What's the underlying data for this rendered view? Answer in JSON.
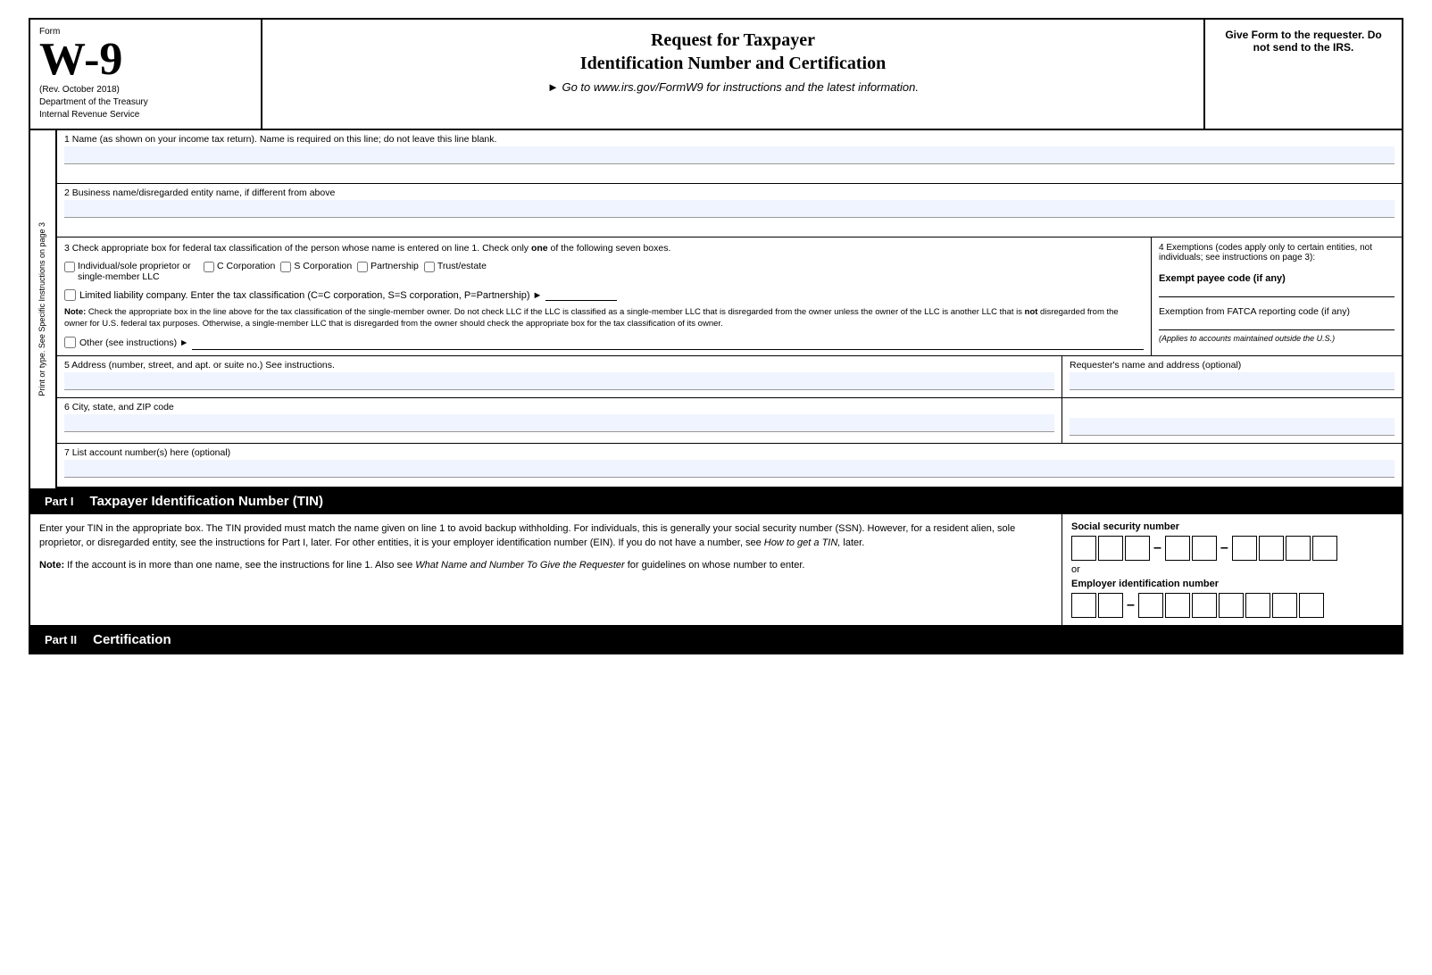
{
  "header": {
    "form_label": "Form",
    "form_number": "W-9",
    "rev_date": "(Rev. October 2018)",
    "dept_line1": "Department of the Treasury",
    "dept_line2": "Internal Revenue Service",
    "title_line1": "Request for Taxpayer",
    "title_line2": "Identification Number and Certification",
    "subtitle": "► Go to www.irs.gov/FormW9 for instructions and the latest information.",
    "give_form": "Give Form to the requester. Do not send to the IRS."
  },
  "sidebar": {
    "text": "Print or type. See Specific Instructions on page 3"
  },
  "fields": {
    "field1_label": "1 Name (as shown on your income tax return). Name is required on this line; do not leave this line blank.",
    "field2_label": "2 Business name/disregarded entity name, if different from above",
    "field3_label": "3 Check appropriate box for federal tax classification of the person whose name is entered on line 1. Check only",
    "field3_label_bold": "one",
    "field3_label2": "of the following seven boxes.",
    "check_individual": "Individual/sole proprietor or single-member LLC",
    "check_c_corp": "C Corporation",
    "check_s_corp": "S Corporation",
    "check_partnership": "Partnership",
    "check_trust": "Trust/estate",
    "llc_label": "Limited liability company. Enter the tax classification (C=C corporation, S=S corporation, P=Partnership) ►",
    "note_label": "Note:",
    "note_text": "Check the appropriate box in the line above for the tax classification of the single-member owner. Do not check LLC if the LLC is classified as a single-member LLC that is disregarded from the owner unless the owner of the LLC is another LLC that is",
    "note_not": "not",
    "note_text2": "disregarded from the owner for U.S. federal tax purposes. Otherwise, a single-member LLC that is disregarded from the owner should check the appropriate box for the tax classification of its owner.",
    "other_label": "Other (see instructions) ►",
    "field4_label": "4 Exemptions (codes apply only to certain entities, not individuals; see instructions on page 3):",
    "exempt_payee": "Exempt payee code (if any)",
    "fatca_label": "Exemption from FATCA reporting code (if any)",
    "fatca_italic": "(Applies to accounts maintained outside the U.S.)",
    "field5_label": "5 Address (number, street, and apt. or suite no.) See instructions.",
    "requester_label": "Requester's name and address (optional)",
    "field6_label": "6 City, state, and ZIP code",
    "field7_label": "7 List account number(s) here (optional)"
  },
  "part1": {
    "label": "Part I",
    "title": "Taxpayer Identification Number (TIN)",
    "desc1": "Enter your TIN in the appropriate box. The TIN provided must match the name given on line 1 to avoid backup withholding. For individuals, this is generally your social security number (SSN). However, for a resident alien, sole proprietor, or disregarded entity, see the instructions for Part I, later. For other entities, it is your employer identification number (EIN). If you do not have a number, see",
    "desc1_italic": "How to get a TIN,",
    "desc1_end": "later.",
    "note_label": "Note:",
    "note_text": "If the account is in more than one name, see the instructions for line 1. Also see",
    "note_italic": "What Name and Number To Give the Requester",
    "note_end": "for guidelines on whose number to enter.",
    "ssn_label": "Social security number",
    "ssn_cells": [
      "",
      "",
      "",
      "",
      "",
      "",
      "",
      "",
      ""
    ],
    "or_text": "or",
    "ein_label": "Employer identification number",
    "ein_cells": [
      "",
      "",
      "",
      "",
      "",
      "",
      "",
      "",
      ""
    ]
  },
  "part2": {
    "label": "Part II",
    "title": "Certification"
  }
}
